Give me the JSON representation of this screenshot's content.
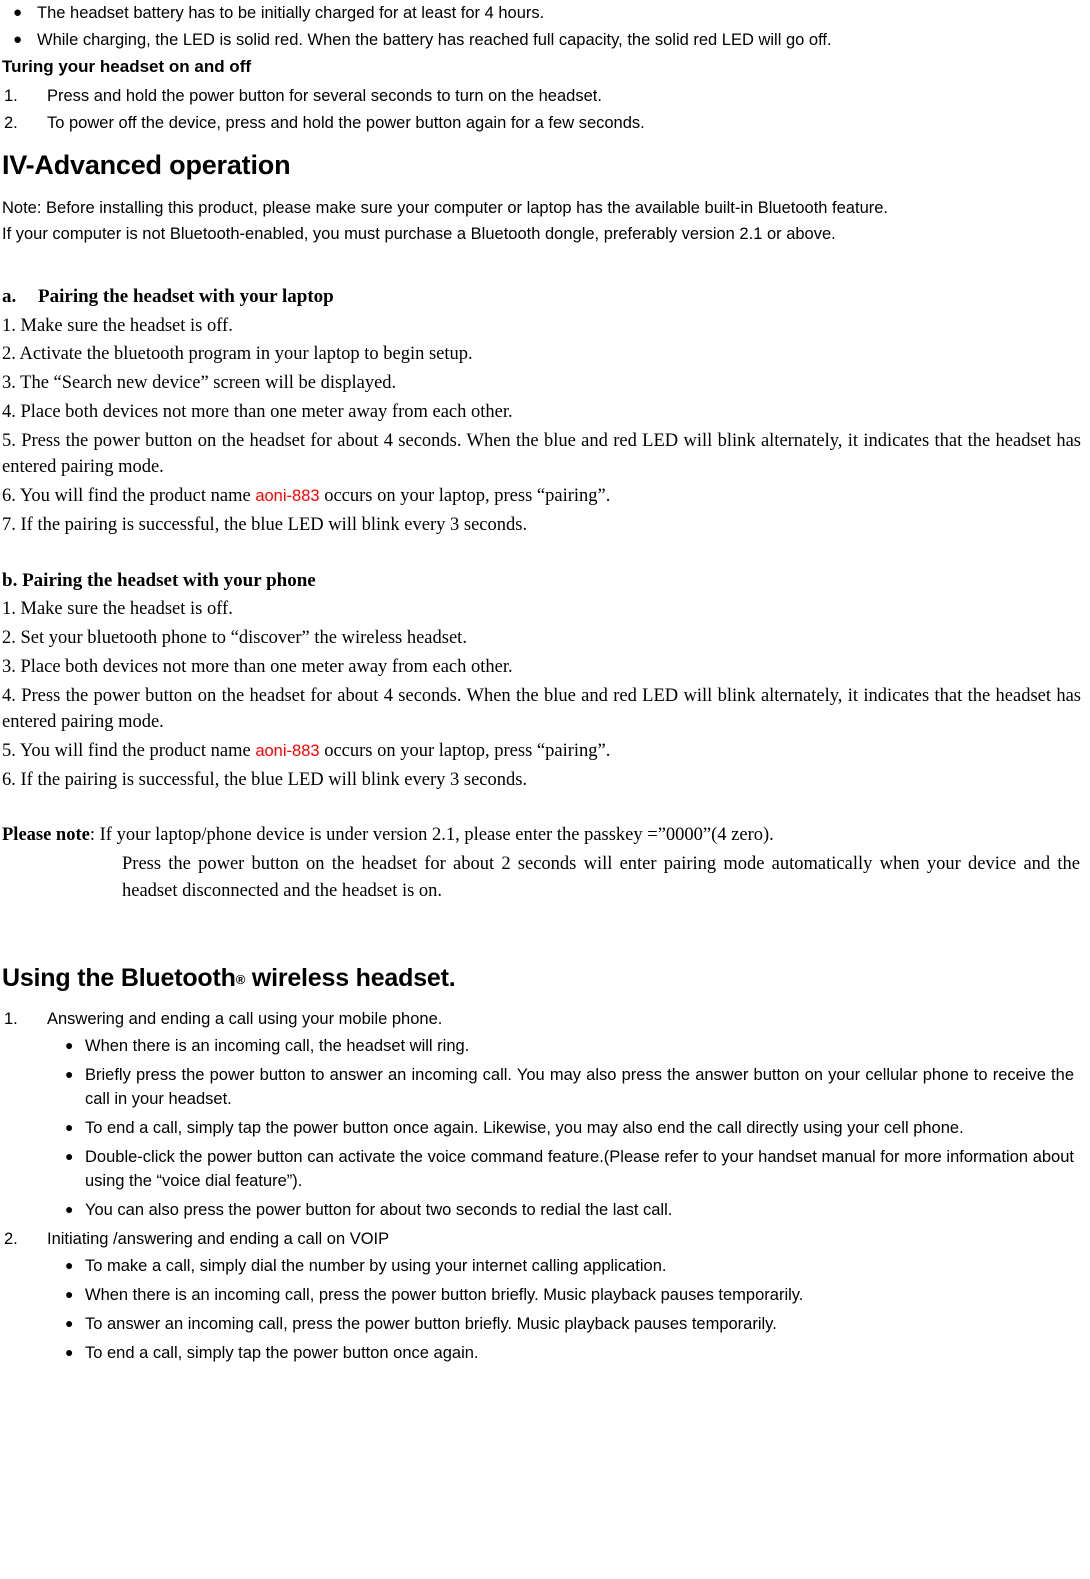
{
  "document": {
    "bullet_glyph": "●",
    "accent_color": "#FF0000",
    "text_color": "#000000",
    "background_color": "#FFFFFF"
  },
  "battery_bullets": [
    "The headset battery has to be initially charged for at least for 4 hours.",
    "While charging, the LED is solid red. When the battery has reached full capacity, the solid red LED will go off."
  ],
  "turning_section": {
    "heading": "Turing your headset on and off",
    "items": [
      {
        "marker": "1.",
        "text": "Press and hold the power button for several seconds to turn on the headset."
      },
      {
        "marker": "2.",
        "text": "To power off the device, press and hold the power button again for a few seconds."
      }
    ]
  },
  "advanced": {
    "heading": "IV-Advanced operation",
    "note_line_1": "Note: Before installing this product, please make sure your computer or laptop has the available built-in Bluetooth feature.",
    "note_line_2": "If your computer is not Bluetooth-enabled, you must purchase a Bluetooth dongle, preferably version 2.1 or above."
  },
  "pairing_laptop": {
    "marker": "a.",
    "heading": "Pairing the headset with your laptop",
    "steps": [
      {
        "text": "1. Make sure the headset is off."
      },
      {
        "text": "2. Activate the bluetooth program in your laptop to begin setup."
      },
      {
        "text": "3. The “Search new device” screen will be displayed."
      },
      {
        "text": "4. Place both devices not more than one meter away from each other."
      },
      {
        "text": "5. Press the power button on the headset for about 4 seconds. When the blue and red LED will blink alternately, it indicates that the headset has entered pairing mode."
      }
    ],
    "step6_before": "6. You will find the product name ",
    "step6_product": "aoni-883",
    "step6_after": " occurs on your laptop, press “pairing”.",
    "step7": "7. If the pairing is successful, the blue LED will blink every 3 seconds."
  },
  "pairing_phone": {
    "heading": "b. Pairing the headset with your phone",
    "steps": [
      {
        "text": "1. Make sure the headset is off."
      },
      {
        "text": "2. Set your bluetooth phone to “discover” the wireless headset."
      },
      {
        "text": "3. Place both devices not more than one meter away from each other."
      },
      {
        "text": "4. Press the power button on the headset for about 4 seconds. When the blue and red LED will blink alternately, it indicates that the headset has entered pairing mode."
      }
    ],
    "step5_before": "5. You will find the product name ",
    "step5_product": "aoni-883",
    "step5_after": " occurs on your laptop, press “pairing”.",
    "step6": "6. If the pairing is successful, the blue LED will blink every 3 seconds."
  },
  "please_note": {
    "label": "Please note",
    "first_line_rest": ": If your laptop/phone device is under version 2.1, please enter the passkey =”0000”(4 zero).",
    "indented": "Press the power button on the headset for about 2 seconds will enter pairing mode automatically when your device and the headset disconnected and the headset is on."
  },
  "using_section": {
    "heading_before": "Using the Bluetooth",
    "heading_reg": "®",
    "heading_after": " wireless headset.",
    "item1": {
      "marker": "1.",
      "text": "Answering and ending a call using your mobile phone.",
      "bullets": [
        "When there is an incoming call, the headset will ring.",
        "Briefly press the power button to answer an incoming call. You may also press the answer button on your cellular phone to receive the call in your headset.",
        "To end a call, simply tap the power button once again. Likewise, you may also end the call directly using your cell phone.",
        "Double-click the power button can activate the voice command feature.(Please refer to your handset manual for more information about using the “voice dial feature”).",
        "You can also press the power button for about two seconds to redial the last call."
      ]
    },
    "item2": {
      "marker": "2.",
      "text": "Initiating /answering and ending a call on VOIP",
      "bullets": [
        "To make a call, simply dial the number by using your internet calling application.",
        "When there is an incoming call, press the power button briefly. Music playback pauses temporarily.",
        "To answer an incoming call, press the power button briefly. Music playback pauses temporarily.",
        "To end a call, simply tap the power button once again."
      ]
    }
  }
}
